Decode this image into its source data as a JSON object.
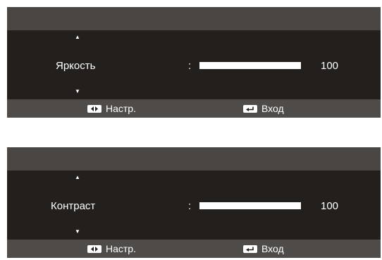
{
  "panels": [
    {
      "item_label": "Яркость",
      "separator": ":",
      "value": "100",
      "level_percent": 100,
      "footer": {
        "adjust_label": "Настр.",
        "enter_label": "Вход"
      }
    },
    {
      "item_label": "Контраст",
      "separator": ":",
      "value": "100",
      "level_percent": 100,
      "footer": {
        "adjust_label": "Настр.",
        "enter_label": "Вход"
      }
    }
  ],
  "icons": {
    "up": "triangle-up-icon",
    "down": "triangle-down-icon",
    "adjust": "left-right-key-icon",
    "enter": "enter-key-icon"
  },
  "colors": {
    "header": "#4a4644",
    "body": "#231f1d",
    "footer": "#4f4b49",
    "bar": "#ffffff"
  }
}
